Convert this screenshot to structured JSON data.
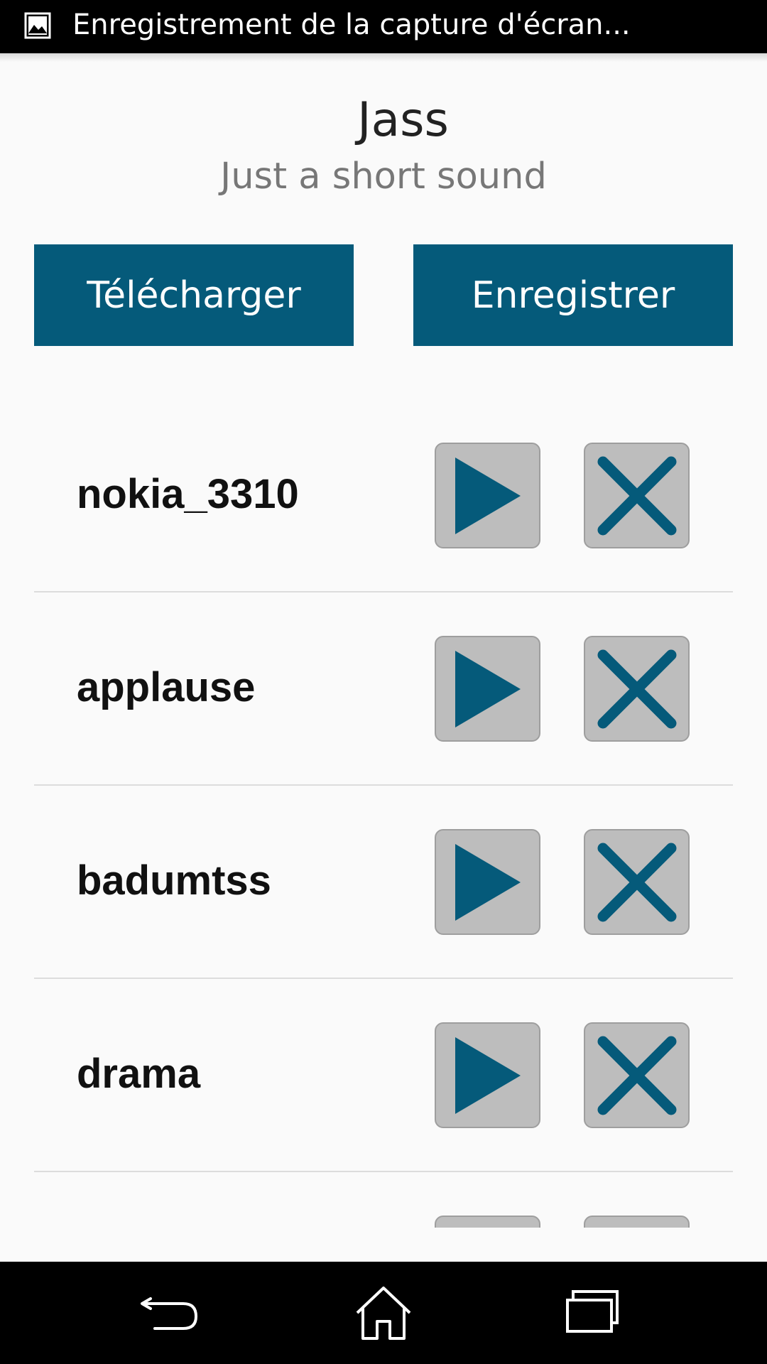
{
  "status_bar": {
    "icon": "image-icon",
    "notification_text": "Enregistrement de la capture d'écran..."
  },
  "header": {
    "title": "Jass",
    "subtitle": "Just a short sound"
  },
  "actions": {
    "download_label": "Télécharger",
    "record_label": "Enregistrer"
  },
  "sounds": [
    {
      "name": "nokia_3310"
    },
    {
      "name": "applause"
    },
    {
      "name": "badumtss"
    },
    {
      "name": "drama"
    },
    {
      "name": ""
    }
  ],
  "icons": {
    "play": "play-icon",
    "delete": "close-icon",
    "back": "back-icon",
    "home": "home-icon",
    "recents": "recents-icon"
  },
  "colors": {
    "accent": "#055a7a",
    "icon_button_bg": "#bdbdbd",
    "background": "#fafafa",
    "bars": "#000000"
  }
}
